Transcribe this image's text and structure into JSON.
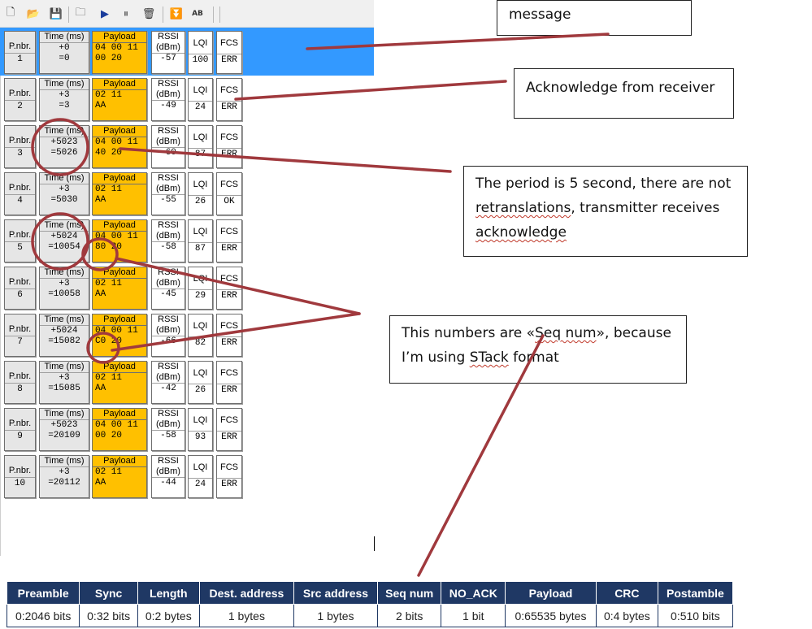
{
  "toolbar": {
    "icons": [
      "new-file-icon",
      "open-folder-icon",
      "save-icon",
      "folder-icon",
      "play-icon",
      "pause-icon",
      "clear-icon",
      "scroll-down-icon",
      "address-book-icon"
    ],
    "glyphs": [
      "🗋",
      "📂",
      "💾",
      "🗀",
      "▶",
      "⏸",
      "🗑",
      "⏬",
      "AB"
    ]
  },
  "column_headers": {
    "pnbr": "P.nbr.",
    "time": "Time (ms)",
    "payload": "Payload",
    "rssi_line1": "RSSI",
    "rssi_line2": "(dBm)",
    "lqi": "LQI",
    "fcs": "FCS"
  },
  "packets": [
    {
      "nbr": "1",
      "delta": "+0",
      "abs": "=0",
      "payload1": "04 00 11",
      "payload2": "00 20",
      "rssi": "-57",
      "lqi": "100",
      "fcs": "ERR",
      "selected": true
    },
    {
      "nbr": "2",
      "delta": "+3",
      "abs": "=3",
      "payload1": "02 11",
      "payload2": "AA",
      "rssi": "-49",
      "lqi": "24",
      "fcs": "ERR"
    },
    {
      "nbr": "3",
      "delta": "+5023",
      "abs": "=5026",
      "payload1": "04 00 11",
      "payload2": "40 20",
      "rssi": "-60",
      "lqi": "87",
      "fcs": "ERR"
    },
    {
      "nbr": "4",
      "delta": "+3",
      "abs": "=5030",
      "payload1": "02 11",
      "payload2": "AA",
      "rssi": "-55",
      "lqi": "26",
      "fcs": "OK"
    },
    {
      "nbr": "5",
      "delta": "+5024",
      "abs": "=10054",
      "payload1": "04 00 11",
      "payload2": "80 20",
      "rssi": "-58",
      "lqi": "87",
      "fcs": "ERR"
    },
    {
      "nbr": "6",
      "delta": "+3",
      "abs": "=10058",
      "payload1": "02 11",
      "payload2": "AA",
      "rssi": "-45",
      "lqi": "29",
      "fcs": "ERR"
    },
    {
      "nbr": "7",
      "delta": "+5024",
      "abs": "=15082",
      "payload1": "04 00 11",
      "payload2": "C0 20",
      "rssi": "-66",
      "lqi": "82",
      "fcs": "ERR"
    },
    {
      "nbr": "8",
      "delta": "+3",
      "abs": "=15085",
      "payload1": "02 11",
      "payload2": "AA",
      "rssi": "-42",
      "lqi": "26",
      "fcs": "ERR"
    },
    {
      "nbr": "9",
      "delta": "+5023",
      "abs": "=20109",
      "payload1": "04 00 11",
      "payload2": "00 20",
      "rssi": "-58",
      "lqi": "93",
      "fcs": "ERR"
    },
    {
      "nbr": "10",
      "delta": "+3",
      "abs": "=20112",
      "payload1": "02 11",
      "payload2": "AA",
      "rssi": "-44",
      "lqi": "24",
      "fcs": "ERR"
    }
  ],
  "callouts": {
    "message": "message",
    "ack": "Acknowledge from receiver",
    "period_line1": "The period is 5 second, there are not",
    "period_line2": "retranslations",
    "period_line2b": ", transmitter receives",
    "period_line3": "acknowledge",
    "seq_line1a": "This numbers are «",
    "seq_line1b": "Seq num",
    "seq_line1c": "», because",
    "seq_line2a": "I’m using ",
    "seq_line2b": "STack",
    "seq_line2c": " format"
  },
  "frame_format": {
    "headers": [
      "Preamble",
      "Sync",
      "Length",
      "Dest. address",
      "Src address",
      "Seq num",
      "NO_ACK",
      "Payload",
      "CRC",
      "Postamble"
    ],
    "values": [
      "0:2046 bits",
      "0:32 bits",
      "0:2 bytes",
      "1 bytes",
      "1 bytes",
      "2 bits",
      "1 bit",
      "0:65535 bytes",
      "0:4 bytes",
      "0:510 bits"
    ]
  },
  "colors": {
    "selection": "#3399ff",
    "payload": "#ffc000",
    "annotation": "#a0393d",
    "table_header": "#1f3864"
  }
}
